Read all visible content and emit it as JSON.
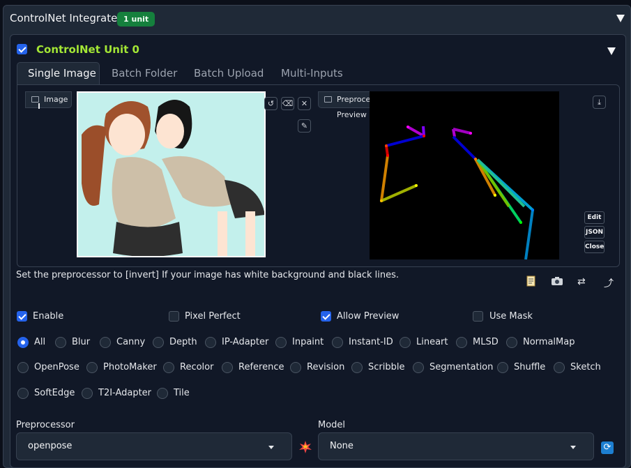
{
  "outer": {
    "title": "ControlNet Integrated",
    "badge": "1 unit"
  },
  "unit": {
    "title": "ControlNet Unit 0",
    "enabled": true
  },
  "tabs": [
    {
      "label": "Single Image",
      "active": true
    },
    {
      "label": "Batch Folder",
      "active": false
    },
    {
      "label": "Batch Upload",
      "active": false
    },
    {
      "label": "Multi-Inputs",
      "active": false
    }
  ],
  "image_panel": {
    "label": "Image",
    "icons": [
      "undo-icon",
      "eraser-icon",
      "close-icon",
      "brush-icon"
    ]
  },
  "preview_panel": {
    "label": "Preprocessor Preview",
    "icons": [
      "download-icon"
    ],
    "buttons": [
      "Edit",
      "JSON",
      "Close"
    ]
  },
  "hint": "Set the preprocessor to [invert] If your image has white background and black lines.",
  "action_icons": [
    "notepad-icon",
    "camera-icon",
    "swap-icon",
    "send-up-icon"
  ],
  "options": [
    {
      "label": "Enable",
      "checked": true
    },
    {
      "label": "Pixel Perfect",
      "checked": false
    },
    {
      "label": "Allow Preview",
      "checked": true
    },
    {
      "label": "Use Mask",
      "checked": false
    }
  ],
  "control_types": [
    "All",
    "Blur",
    "Canny",
    "Depth",
    "IP-Adapter",
    "Inpaint",
    "Instant-ID",
    "Lineart",
    "MLSD",
    "NormalMap",
    "OpenPose",
    "PhotoMaker",
    "Recolor",
    "Reference",
    "Revision",
    "Scribble",
    "Segmentation",
    "Shuffle",
    "Sketch",
    "SoftEdge",
    "T2I-Adapter",
    "Tile"
  ],
  "selected_control_type": "All",
  "preprocessor": {
    "label": "Preprocessor",
    "value": "openpose"
  },
  "model": {
    "label": "Model",
    "value": "None"
  },
  "colors": {
    "accent": "#2563eb",
    "unit_title": "#a3e635",
    "badge": "#15803d"
  }
}
